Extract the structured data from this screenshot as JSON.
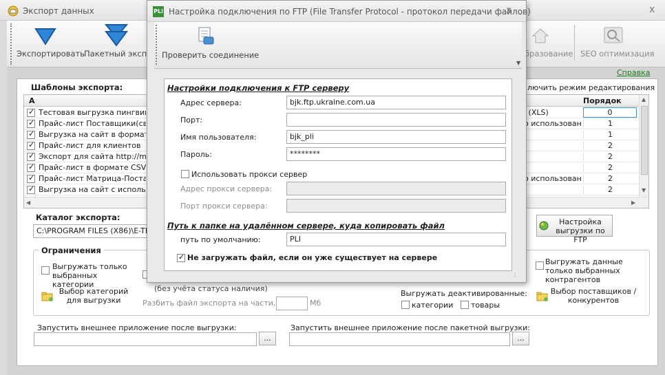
{
  "main": {
    "title": "Экспорт данных",
    "toolbar": {
      "export_label": "Экспортировать",
      "batch_label": "Пакетный экспо",
      "image_label": "бразование",
      "seo_label": "SEO оптимизация"
    },
    "help_link": "Справка",
    "templates": {
      "heading": "Шаблоны экспорта:",
      "edit_mode_label": "лючить режим редактирования",
      "col_a": "A",
      "col_order": "Порядок",
      "rows": [
        {
          "checked": true,
          "name": "Тестовая выгрузка пингвинов",
          "format": "l (XLS)",
          "order": "0"
        },
        {
          "checked": true,
          "name": "Прайс-лист Поставщики(сводн",
          "format": "о использования",
          "order": "1"
        },
        {
          "checked": true,
          "name": "Выгрузка на сайт в формате E",
          "format": "",
          "order": "1"
        },
        {
          "checked": true,
          "name": "Прайс-лист для клиентов",
          "format": "",
          "order": "2"
        },
        {
          "checked": true,
          "name": "Экспорт для сайта http://mark",
          "format": "",
          "order": "2"
        },
        {
          "checked": true,
          "name": "Прайс-лист в формате CSV",
          "format": "",
          "order": "2"
        },
        {
          "checked": true,
          "name": "Прайс-лист Матрица-Поставщ",
          "format": "о использования",
          "order": "2"
        },
        {
          "checked": true,
          "name": "Выгрузка на сайт с использова",
          "format": "",
          "order": "2"
        }
      ]
    },
    "catalog": {
      "label": "Каталог экспорта:",
      "value": "C:\\PROGRAM FILES (X86)\\E-TRA"
    },
    "ftp_settings_button": "Настройка выгрузки по FTP",
    "restrictions": {
      "heading": "Ограничения",
      "only_categories": "Выгружать только выбранных категории",
      "select_categories": "Выбор категорий для выгрузки",
      "stock_note": "(без учёта статуса наличия)",
      "split_label": "Разбить файл экспорта на части, по:",
      "split_value": "",
      "split_unit": "Мб",
      "deactivated_label": "Выгружать деактивированные:",
      "categories": "категории",
      "goods": "товары",
      "only_contractors": "Выгружать данные только выбранных контрагентов",
      "select_suppliers": "Выбор поставщиков / конкурентов"
    },
    "run_after": {
      "label": "Запустить внешнее приложение после выгрузки:",
      "value": "",
      "browse": "..."
    },
    "run_after_batch": {
      "label": "Запустить внешнее приложение после пакетной выгрузки:",
      "value": "",
      "browse": "..."
    }
  },
  "dialog": {
    "title": "Настройка подключения по FTP (File Transfer Protocol - протокол передачи файлов)",
    "logo_text": "PLi",
    "close": "x",
    "check_connection": "Проверить соединение",
    "section_connection": "Настройки подключения к FTP серверу",
    "server_label": "Адрес сервера:",
    "server_value": "bjk.ftp.ukraine.com.ua",
    "port_label": "Порт:",
    "port_value": "",
    "user_label": "Имя пользователя:",
    "user_value": "bjk_pli",
    "password_label": "Пароль:",
    "password_value": "********",
    "use_proxy": "Использовать прокси сервер",
    "proxy_address_label": "Адрес прокси сервера:",
    "proxy_port_label": "Порт прокси сервера:",
    "section_path": "Путь к папке на удалённом сервере, куда копировать файл",
    "path_label": "путь по умолчанию:",
    "path_value": "PLI",
    "no_overwrite": "Не загружать файл, если он уже существует на сервере"
  },
  "colors": {
    "help_link": "#1a7a1a",
    "dialog_logo": "#3a8f3a",
    "arrow": "#1f6fbf"
  }
}
